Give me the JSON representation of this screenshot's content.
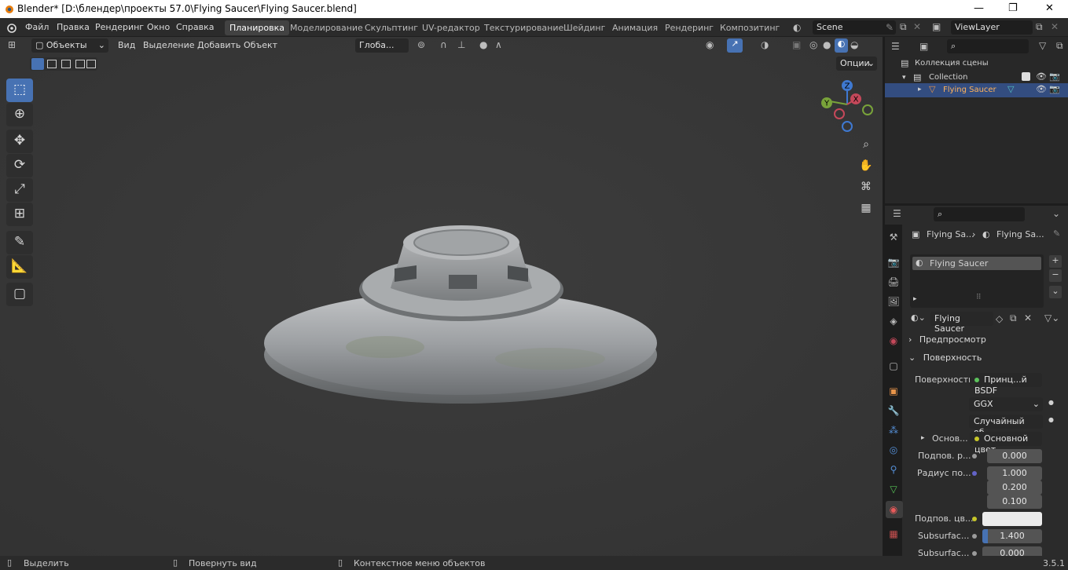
{
  "window": {
    "title": "Blender* [D:\\блендер\\проекты 57.0\\Flying Saucer\\Flying Saucer.blend]",
    "minimize": "—",
    "maximize": "❐",
    "close": "✕"
  },
  "topbar": {
    "menus": [
      "Файл",
      "Правка",
      "Рендеринг",
      "Окно",
      "Справка"
    ],
    "workspaces": [
      "Планировка",
      "Моделирование",
      "Скульптинг",
      "UV-редактор",
      "Текстурирование",
      "Шейдинг",
      "Анимация",
      "Рендеринг",
      "Композитинг"
    ],
    "active_workspace": "Планировка",
    "scene": "Scene",
    "view_layer": "ViewLayer"
  },
  "viewport": {
    "mode": "Объекты",
    "menus": [
      "Вид",
      "Выделение",
      "Добавить",
      "Объект"
    ],
    "transform_orientation": "Глоба...",
    "options_label": "Опции",
    "gizmo": {
      "z": "Z",
      "y": "Y",
      "x": "X"
    }
  },
  "outliner": {
    "root": "Коллекция сцены",
    "collection": "Collection",
    "object": "Flying Saucer"
  },
  "properties": {
    "breadcrumb": [
      "Flying Sa...",
      "Flying Sa..."
    ],
    "material_slot": "Flying Saucer",
    "material_name": "Flying Saucer",
    "sections": {
      "preview": "Предпросмотр",
      "surface": "Поверхность"
    },
    "rows": [
      {
        "label": "Поверхность",
        "value": "Принц...й BSDF",
        "dot": "#5cc35c"
      },
      {
        "label": "",
        "value": "GGX"
      },
      {
        "label": "",
        "value": "Случайный об..."
      },
      {
        "label": "Основ...",
        "value": "Основной цвет",
        "dot": "#c7c729"
      },
      {
        "label": "Подпов. р...",
        "value": "0.000",
        "dot": "#9b9b9b"
      },
      {
        "label": "Радиус по...",
        "value": "1.000",
        "dot": "#6363c7"
      },
      {
        "label": "",
        "value": "0.200"
      },
      {
        "label": "",
        "value": "0.100"
      },
      {
        "label": "Подпов. цв...",
        "value": "",
        "dot": "#c7c729"
      },
      {
        "label": "Subsurfac...",
        "value": "1.400",
        "dot": "#9b9b9b"
      },
      {
        "label": "Subsurfac...",
        "value": "0.000",
        "dot": "#9b9b9b"
      }
    ]
  },
  "statusbar": {
    "select": "Выделить",
    "rotate": "Повернуть вид",
    "context": "Контекстное меню объектов",
    "version": "3.5.1"
  }
}
